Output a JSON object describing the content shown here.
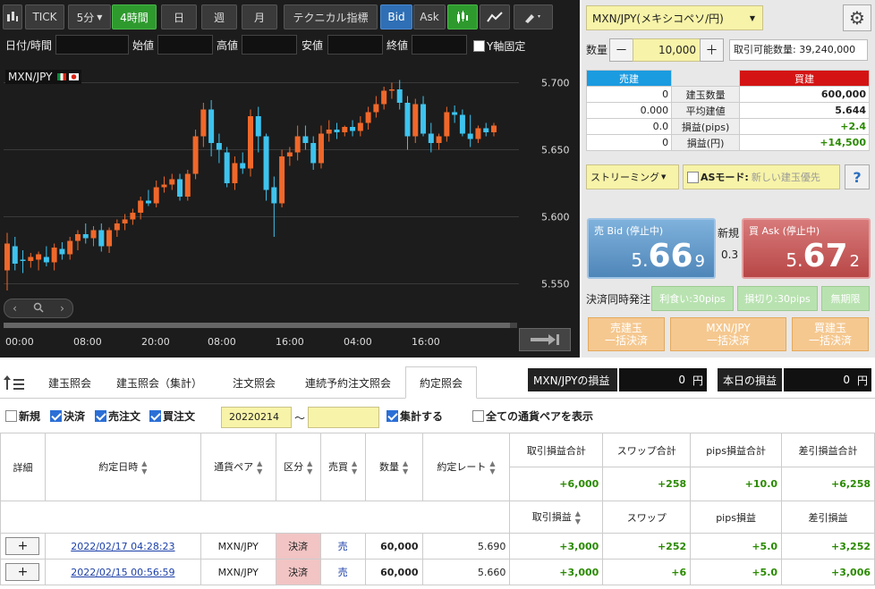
{
  "toolbar": {
    "tick": "TICK",
    "interval": "5分",
    "interval_arrow": "▼",
    "period_selected": "4時間",
    "day": "日",
    "week": "週",
    "month": "月",
    "technical": "テクニカル指標",
    "bid": "Bid",
    "ask": "Ask"
  },
  "ohlc": {
    "datetime_label": "日付/時間",
    "open_label": "始値",
    "high_label": "高値",
    "low_label": "安値",
    "close_label": "終値",
    "yfix_label": "Y軸固定"
  },
  "chart_legend": "MXN/JPY",
  "chart_data": {
    "type": "candlestick",
    "title": "MXN/JPY",
    "y_ticks": [
      "5.700",
      "5.650",
      "5.600",
      "5.550"
    ],
    "x_ticks": [
      "00:00",
      "08:00",
      "20:00",
      "08:00",
      "16:00",
      "04:00",
      "16:00"
    ],
    "ylim": [
      5.535,
      5.715
    ],
    "candles": [
      {
        "o": 5.56,
        "h": 5.588,
        "l": 5.545,
        "c": 5.58
      },
      {
        "o": 5.578,
        "h": 5.585,
        "l": 5.56,
        "c": 5.565
      },
      {
        "o": 5.568,
        "h": 5.575,
        "l": 5.558,
        "c": 5.567
      },
      {
        "o": 5.567,
        "h": 5.573,
        "l": 5.562,
        "c": 5.57
      },
      {
        "o": 5.568,
        "h": 5.574,
        "l": 5.56,
        "c": 5.572
      },
      {
        "o": 5.57,
        "h": 5.578,
        "l": 5.563,
        "c": 5.566
      },
      {
        "o": 5.566,
        "h": 5.58,
        "l": 5.56,
        "c": 5.577
      },
      {
        "o": 5.576,
        "h": 5.581,
        "l": 5.568,
        "c": 5.572
      },
      {
        "o": 5.572,
        "h": 5.585,
        "l": 5.568,
        "c": 5.582
      },
      {
        "o": 5.582,
        "h": 5.59,
        "l": 5.575,
        "c": 5.587
      },
      {
        "o": 5.587,
        "h": 5.595,
        "l": 5.58,
        "c": 5.584
      },
      {
        "o": 5.584,
        "h": 5.593,
        "l": 5.578,
        "c": 5.59
      },
      {
        "o": 5.59,
        "h": 5.595,
        "l": 5.574,
        "c": 5.578
      },
      {
        "o": 5.578,
        "h": 5.592,
        "l": 5.573,
        "c": 5.59
      },
      {
        "o": 5.59,
        "h": 5.598,
        "l": 5.585,
        "c": 5.595
      },
      {
        "o": 5.595,
        "h": 5.602,
        "l": 5.59,
        "c": 5.598
      },
      {
        "o": 5.598,
        "h": 5.606,
        "l": 5.594,
        "c": 5.603
      },
      {
        "o": 5.603,
        "h": 5.615,
        "l": 5.598,
        "c": 5.612
      },
      {
        "o": 5.612,
        "h": 5.62,
        "l": 5.608,
        "c": 5.61
      },
      {
        "o": 5.61,
        "h": 5.627,
        "l": 5.607,
        "c": 5.622
      },
      {
        "o": 5.622,
        "h": 5.63,
        "l": 5.618,
        "c": 5.624
      },
      {
        "o": 5.624,
        "h": 5.632,
        "l": 5.62,
        "c": 5.628
      },
      {
        "o": 5.628,
        "h": 5.632,
        "l": 5.612,
        "c": 5.615
      },
      {
        "o": 5.615,
        "h": 5.635,
        "l": 5.612,
        "c": 5.632
      },
      {
        "o": 5.632,
        "h": 5.665,
        "l": 5.628,
        "c": 5.66
      },
      {
        "o": 5.66,
        "h": 5.685,
        "l": 5.652,
        "c": 5.68
      },
      {
        "o": 5.68,
        "h": 5.687,
        "l": 5.645,
        "c": 5.655
      },
      {
        "o": 5.655,
        "h": 5.662,
        "l": 5.64,
        "c": 5.65
      },
      {
        "o": 5.648,
        "h": 5.652,
        "l": 5.622,
        "c": 5.625
      },
      {
        "o": 5.625,
        "h": 5.645,
        "l": 5.62,
        "c": 5.64
      },
      {
        "o": 5.64,
        "h": 5.648,
        "l": 5.632,
        "c": 5.636
      },
      {
        "o": 5.636,
        "h": 5.68,
        "l": 5.63,
        "c": 5.675
      },
      {
        "o": 5.675,
        "h": 5.682,
        "l": 5.648,
        "c": 5.66
      },
      {
        "o": 5.66,
        "h": 5.662,
        "l": 5.612,
        "c": 5.62
      },
      {
        "o": 5.622,
        "h": 5.63,
        "l": 5.585,
        "c": 5.61
      },
      {
        "o": 5.61,
        "h": 5.65,
        "l": 5.607,
        "c": 5.645
      },
      {
        "o": 5.645,
        "h": 5.652,
        "l": 5.638,
        "c": 5.648
      },
      {
        "o": 5.648,
        "h": 5.668,
        "l": 5.642,
        "c": 5.66
      },
      {
        "o": 5.66,
        "h": 5.668,
        "l": 5.65,
        "c": 5.655
      },
      {
        "o": 5.655,
        "h": 5.66,
        "l": 5.635,
        "c": 5.64
      },
      {
        "o": 5.64,
        "h": 5.668,
        "l": 5.636,
        "c": 5.662
      },
      {
        "o": 5.662,
        "h": 5.672,
        "l": 5.656,
        "c": 5.665
      },
      {
        "o": 5.665,
        "h": 5.67,
        "l": 5.658,
        "c": 5.663
      },
      {
        "o": 5.663,
        "h": 5.668,
        "l": 5.66,
        "c": 5.667
      },
      {
        "o": 5.667,
        "h": 5.672,
        "l": 5.66,
        "c": 5.664
      },
      {
        "o": 5.664,
        "h": 5.675,
        "l": 5.66,
        "c": 5.67
      },
      {
        "o": 5.67,
        "h": 5.682,
        "l": 5.665,
        "c": 5.678
      },
      {
        "o": 5.678,
        "h": 5.69,
        "l": 5.674,
        "c": 5.684
      },
      {
        "o": 5.684,
        "h": 5.697,
        "l": 5.68,
        "c": 5.694
      },
      {
        "o": 5.694,
        "h": 5.7,
        "l": 5.688,
        "c": 5.695
      },
      {
        "o": 5.695,
        "h": 5.702,
        "l": 5.68,
        "c": 5.685
      },
      {
        "o": 5.685,
        "h": 5.69,
        "l": 5.65,
        "c": 5.66
      },
      {
        "o": 5.66,
        "h": 5.688,
        "l": 5.655,
        "c": 5.684
      },
      {
        "o": 5.684,
        "h": 5.69,
        "l": 5.66,
        "c": 5.662
      },
      {
        "o": 5.662,
        "h": 5.67,
        "l": 5.648,
        "c": 5.655
      },
      {
        "o": 5.655,
        "h": 5.662,
        "l": 5.65,
        "c": 5.66
      },
      {
        "o": 5.66,
        "h": 5.682,
        "l": 5.656,
        "c": 5.678
      },
      {
        "o": 5.678,
        "h": 5.683,
        "l": 5.67,
        "c": 5.676
      },
      {
        "o": 5.676,
        "h": 5.68,
        "l": 5.66,
        "c": 5.662
      },
      {
        "o": 5.662,
        "h": 5.676,
        "l": 5.652,
        "c": 5.658
      },
      {
        "o": 5.658,
        "h": 5.668,
        "l": 5.655,
        "c": 5.666
      },
      {
        "o": 5.666,
        "h": 5.67,
        "l": 5.66,
        "c": 5.663
      },
      {
        "o": 5.663,
        "h": 5.67,
        "l": 5.66,
        "c": 5.668
      }
    ]
  },
  "right": {
    "pair": "MXN/JPY(メキシコペソ/円)",
    "qty_label": "数量",
    "minus": "－",
    "plus": "＋",
    "qty_value": "10,000",
    "max_qty": "取引可能数量: 39,240,000",
    "sell_header": "売建",
    "buy_header": "買建",
    "rows": [
      {
        "sell": "0",
        "label": "建玉数量",
        "buy": "600,000"
      },
      {
        "sell": "0.000",
        "label": "平均建値",
        "buy": "5.644"
      },
      {
        "sell": "0.0",
        "label": "損益(pips)",
        "buy": "+2.4"
      },
      {
        "sell": "0",
        "label": "損益(円)",
        "buy": "+14,500"
      }
    ],
    "streaming": "ストリーミング",
    "as_mode_label": "ASモード:",
    "as_mode_value": "新しい建玉優先",
    "help": "?",
    "bid_header": "売 Bid (停止中)",
    "bid_p1": "5.",
    "bid_p2": "66",
    "bid_p3": "9",
    "ask_header": "買 Ask (停止中)",
    "ask_p1": "5.",
    "ask_p2": "67",
    "ask_p3": "2",
    "shinki": "新規",
    "spread": "0.3",
    "settle_label": "決済同時発注",
    "take_profit": "利食い:30pips",
    "stop_loss": "損切り:30pips",
    "unlimited": "無期限",
    "sell_settle_1": "売建玉",
    "sell_settle_2": "一括決済",
    "pair_settle_1": "MXN/JPY",
    "pair_settle_2": "一括決済",
    "buy_settle_1": "買建玉",
    "buy_settle_2": "一括決済"
  },
  "tabs": [
    "建玉照会",
    "建玉照会（集計）",
    "注文照会",
    "連続予約注文照会",
    "約定照会"
  ],
  "pl": {
    "pair_label": "MXN/JPYの損益",
    "pair_value": "0",
    "pair_unit": "円",
    "today_label": "本日の損益",
    "today_value": "0",
    "today_unit": "円"
  },
  "filters": {
    "new": "新規",
    "settle": "決済",
    "sell_order": "売注文",
    "buy_order": "買注文",
    "date_from": "20220214",
    "tilde": "～",
    "date_to": "",
    "aggregate": "集計する",
    "all_pairs": "全ての通貨ペアを表示"
  },
  "table": {
    "headers": [
      "詳細",
      "約定日時",
      "通貨ペア",
      "区分",
      "売買",
      "数量",
      "約定レート"
    ],
    "sum_headers": [
      "取引損益合計",
      "スワップ合計",
      "pips損益合計",
      "差引損益合計"
    ],
    "sum_values": [
      "+6,000",
      "+258",
      "+10.0",
      "+6,258"
    ],
    "sub_headers": [
      "取引損益",
      "スワップ",
      "pips損益",
      "差引損益"
    ],
    "rows": [
      {
        "btn": "+",
        "date": "2022/02/17 04:28:23",
        "pair": "MXN/JPY",
        "kbn": "決済",
        "side": "売",
        "qty": "60,000",
        "rate": "5.690",
        "pl": "+3,000",
        "swap": "+252",
        "pips": "+5.0",
        "net": "+3,252"
      },
      {
        "btn": "+",
        "date": "2022/02/15 00:56:59",
        "pair": "MXN/JPY",
        "kbn": "決済",
        "side": "売",
        "qty": "60,000",
        "rate": "5.660",
        "pl": "+3,000",
        "swap": "+6",
        "pips": "+5.0",
        "net": "+3,006"
      }
    ]
  }
}
